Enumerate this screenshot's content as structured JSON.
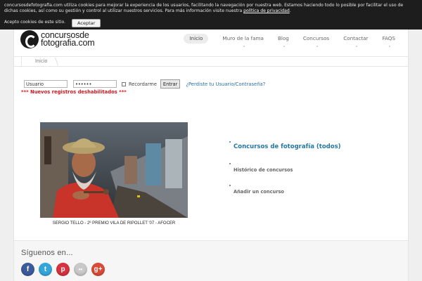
{
  "cookie_bar": {
    "text": "concursosdefotografia.com utiliza cookies para mejorar la experiencia de los usuarios, facilitando la navegación por nuestra web. Estamos haciendo todo lo posible por facilitar el uso de dichas cookies, así como su gestión y control al utilizar nuestros servicios. Para más información visite nuestra",
    "link": "política de privacidad",
    "accept_text": "Acepto cookies de este sitio.",
    "accept_button": "Aceptar"
  },
  "logo": {
    "line1": "concursosde",
    "line2": "fotografia.com"
  },
  "nav": {
    "items": [
      {
        "label": "Inicio"
      },
      {
        "label": "Muro de la fama"
      },
      {
        "label": "Blog"
      },
      {
        "label": "Concursos"
      },
      {
        "label": "Contactar"
      },
      {
        "label": "FAQS"
      }
    ]
  },
  "breadcrumb": {
    "label": "Inicio"
  },
  "login": {
    "user_value": "Usuario",
    "password_value": "••••••",
    "remember_label": "Recordarme",
    "enter_button": "Entrar",
    "forgot_link": "¿Perdiste tu Usuario/Contraseña?",
    "warning": "*** Nuevos registros deshabilitados ***"
  },
  "photo": {
    "caption": "SERGIO TELLO  - 2º PREMIO VILA DE RIPOLLET '07 - AFOCER"
  },
  "links": {
    "main": "Concursos de fotografía (todos)",
    "historic": "Histórico de concursos",
    "add": "Añadir un concurso"
  },
  "footer": {
    "title": "Síguenos en...",
    "socials": [
      {
        "name": "facebook",
        "glyph": "f",
        "color": "#3b5b9a"
      },
      {
        "name": "twitter",
        "glyph": "t",
        "color": "#35a6da"
      },
      {
        "name": "pinterest",
        "glyph": "p",
        "color": "#d6323f"
      },
      {
        "name": "flickr",
        "glyph": "••",
        "color": "#c9c9c9"
      },
      {
        "name": "google-plus",
        "glyph": "g+",
        "color": "#dc4b38"
      }
    ]
  },
  "colors": {
    "accent_link": "#2477a6",
    "warning": "#d8161d",
    "cookie_bar": "#1d1d1d"
  }
}
